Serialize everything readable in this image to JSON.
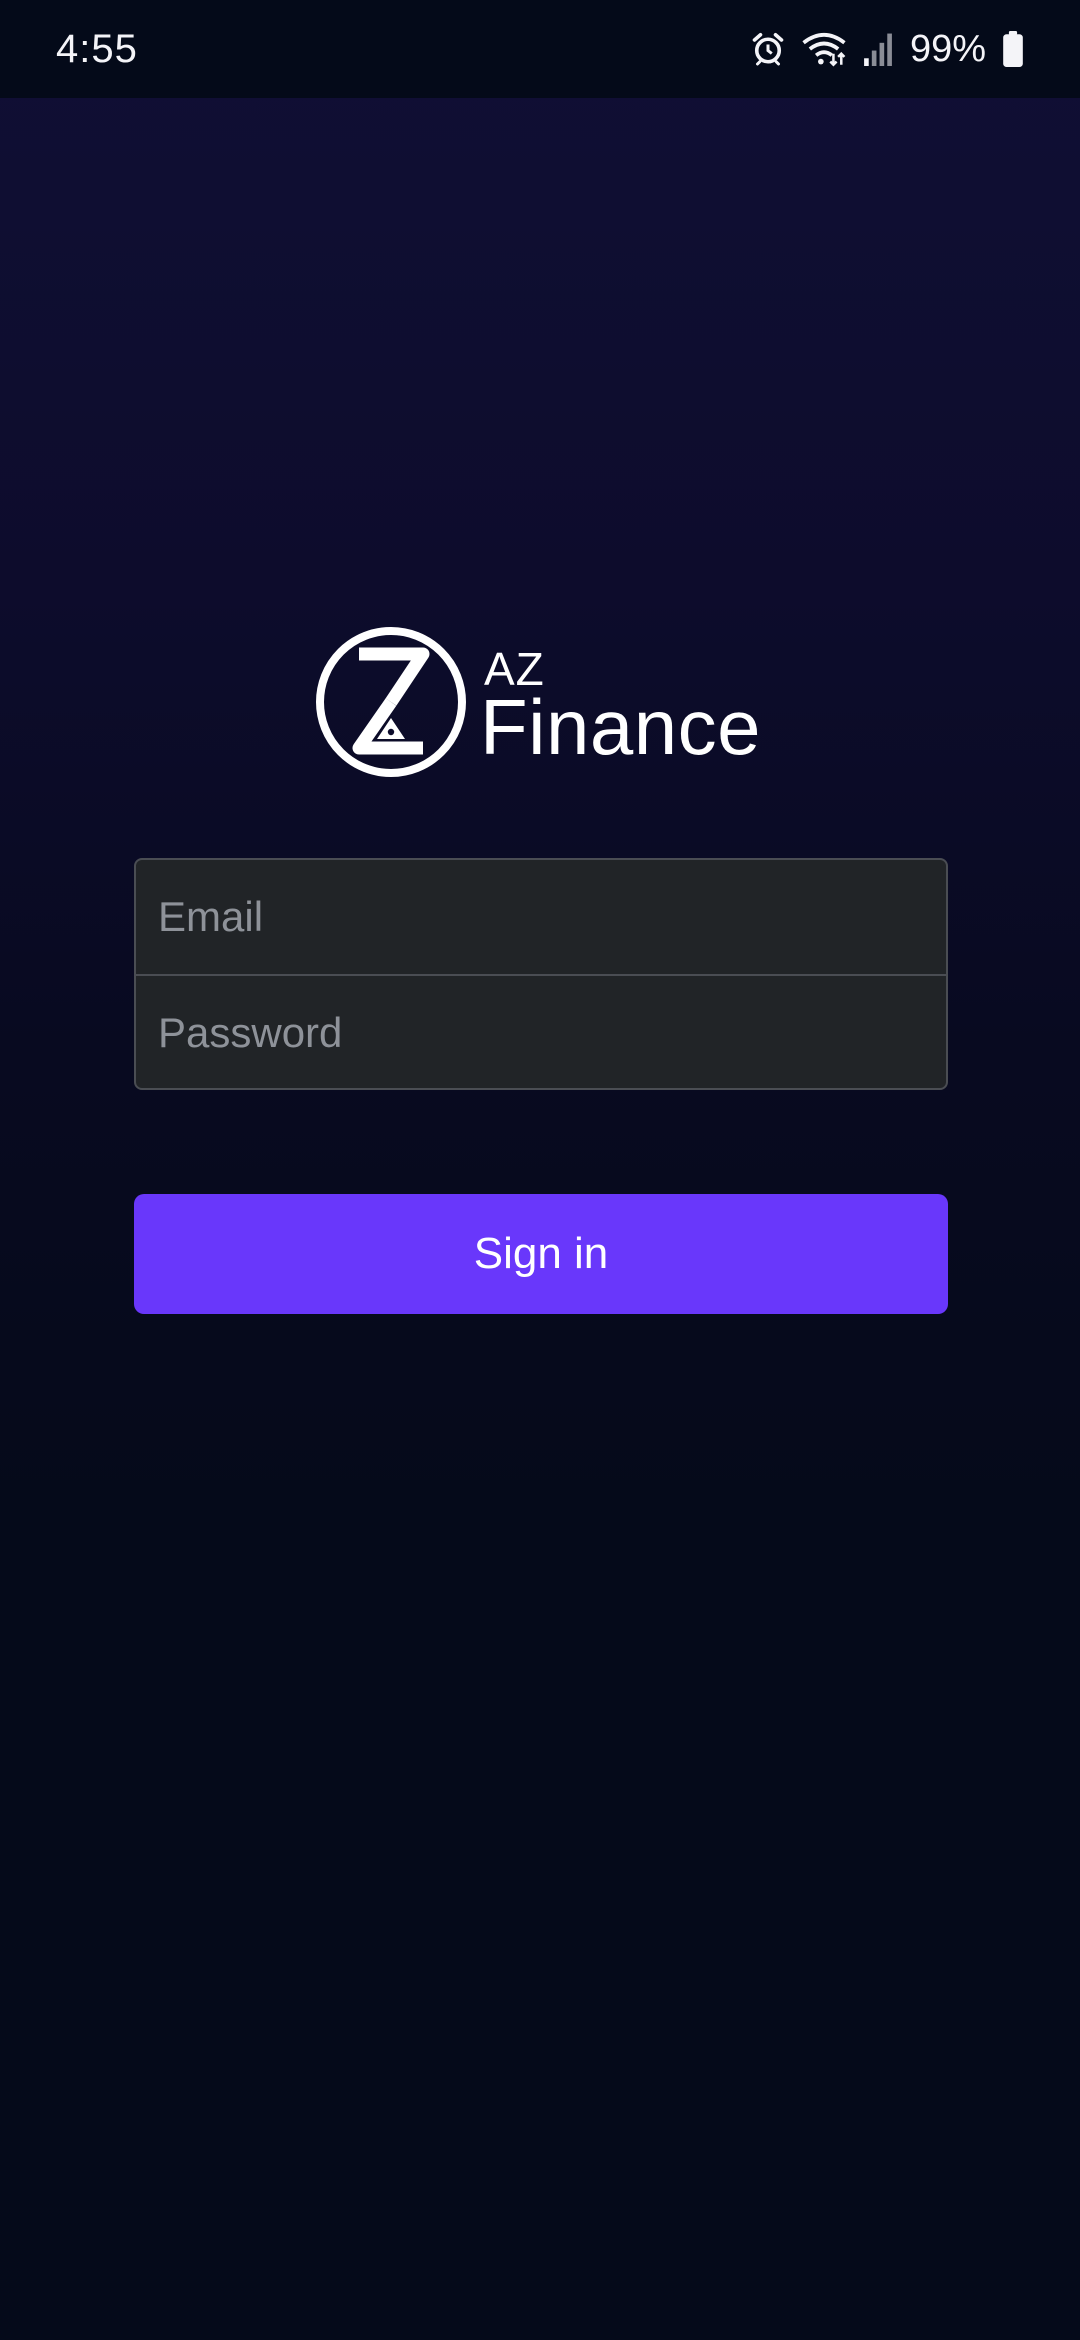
{
  "status_bar": {
    "time": "4:55",
    "battery_percent": "99%",
    "icons": [
      "alarm-icon",
      "wifi-icon",
      "signal-icon",
      "battery-icon"
    ]
  },
  "brand": {
    "name_small": "AZ",
    "name_large": "Finance",
    "logo_icon": "az-logo-icon"
  },
  "login": {
    "email_placeholder": "Email",
    "email_value": "",
    "password_placeholder": "Password",
    "password_value": "",
    "sign_in_label": "Sign in"
  },
  "colors": {
    "accent": "#6937fb",
    "field_background": "#212427",
    "field_border": "#4a4d53",
    "placeholder": "#8e9299",
    "background_top": "#100f35",
    "background_bottom": "#050a1a"
  }
}
